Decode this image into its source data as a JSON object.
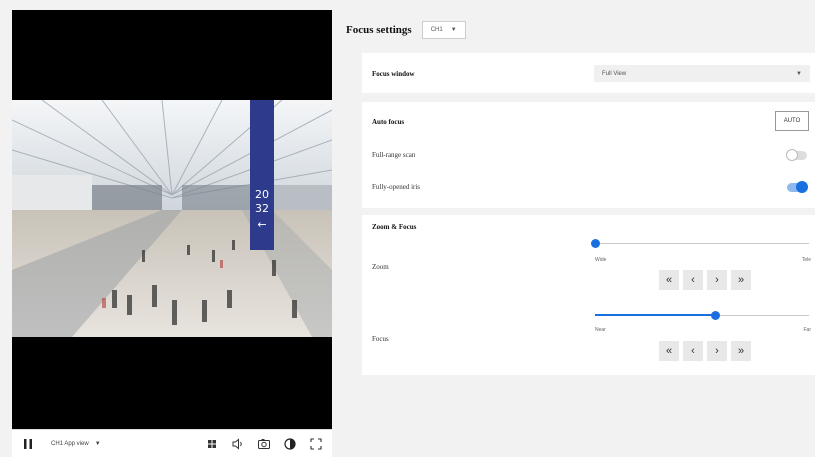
{
  "player": {
    "view_label": "CH1 App view",
    "icons": [
      "pause-icon",
      "chevron-down-icon",
      "grid-icon",
      "volume-icon",
      "camera-icon",
      "contrast-icon",
      "fullscreen-icon"
    ]
  },
  "settings": {
    "title": "Focus settings",
    "channel": "CH1",
    "focus_window": {
      "label": "Focus window",
      "value": "Full View"
    },
    "auto_focus": {
      "label": "Auto focus",
      "button": "AUTO",
      "full_range_scan": {
        "label": "Full-range scan",
        "on": false
      },
      "fully_opened_iris": {
        "label": "Fully-opened iris",
        "on": true
      }
    },
    "zoom_focus": {
      "title": "Zoom & Focus",
      "zoom": {
        "label": "Zoom",
        "min_label": "Wide",
        "max_label": "Tele",
        "level": 0.0
      },
      "focus": {
        "label": "Focus",
        "min_label": "Near",
        "max_label": "Far",
        "level": 0.56
      },
      "steps": [
        "«",
        "‹",
        "›",
        "»"
      ]
    }
  },
  "colors": {
    "accent": "#1a6fe0",
    "panel_bg": "#f2f2f2",
    "video_bg": "#000000"
  }
}
